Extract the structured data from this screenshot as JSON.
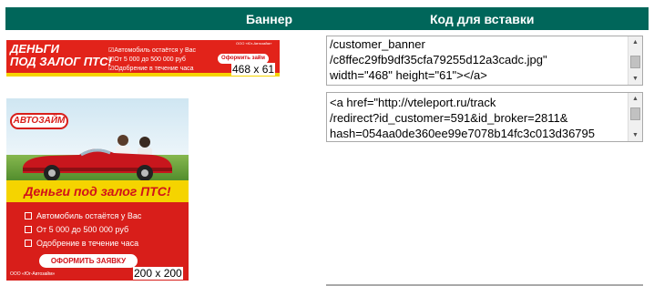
{
  "header": {
    "col_banner": "Баннер",
    "col_code": "Код для вставки",
    "bg_color": "#00665a"
  },
  "banners": [
    {
      "size_label": "468 x 61",
      "title_line1": "ДЕНЬГИ",
      "title_line2": "ПОД ЗАЛОГ ПТС!",
      "features": [
        "Автомобиль остаётся у Вас",
        "От 5 000 до 500 000 руб",
        "Одобрение в течение часа"
      ],
      "button": "Оформить займ",
      "brand": "ООО «Юг-Автозайм»",
      "code_text": "/customer_banner\n/c8ffec29fb9df35cfa79255d12a3cadc.jpg\"\nwidth=\"468\" height=\"61\"></a>"
    },
    {
      "size_label": "200 x 200",
      "logo": "АВТОЗАЙМ",
      "headline": "Деньги под залог ПТС!",
      "features": [
        "Автомобиль остаётся у Вас",
        "От 5 000 до 500 000 руб",
        "Одобрение в течение часа"
      ],
      "button": "ОФОРМИТЬ ЗАЯВКУ",
      "brand": "ООО «Юг-Автозайм»",
      "code_text": "<a href=\"http://vteleport.ru/track\n/redirect?id_customer=591&id_broker=2811&\nhash=054aa0de360ee99e7078b14fc3c013d36795"
    }
  ],
  "colors": {
    "brand_red": "#d81e1a",
    "accent_yellow": "#f5d400",
    "header_green": "#00665a"
  },
  "icons": {
    "scroll_up": "triangle-up-icon",
    "scroll_down": "triangle-down-icon",
    "check": "checkbox-icon"
  }
}
